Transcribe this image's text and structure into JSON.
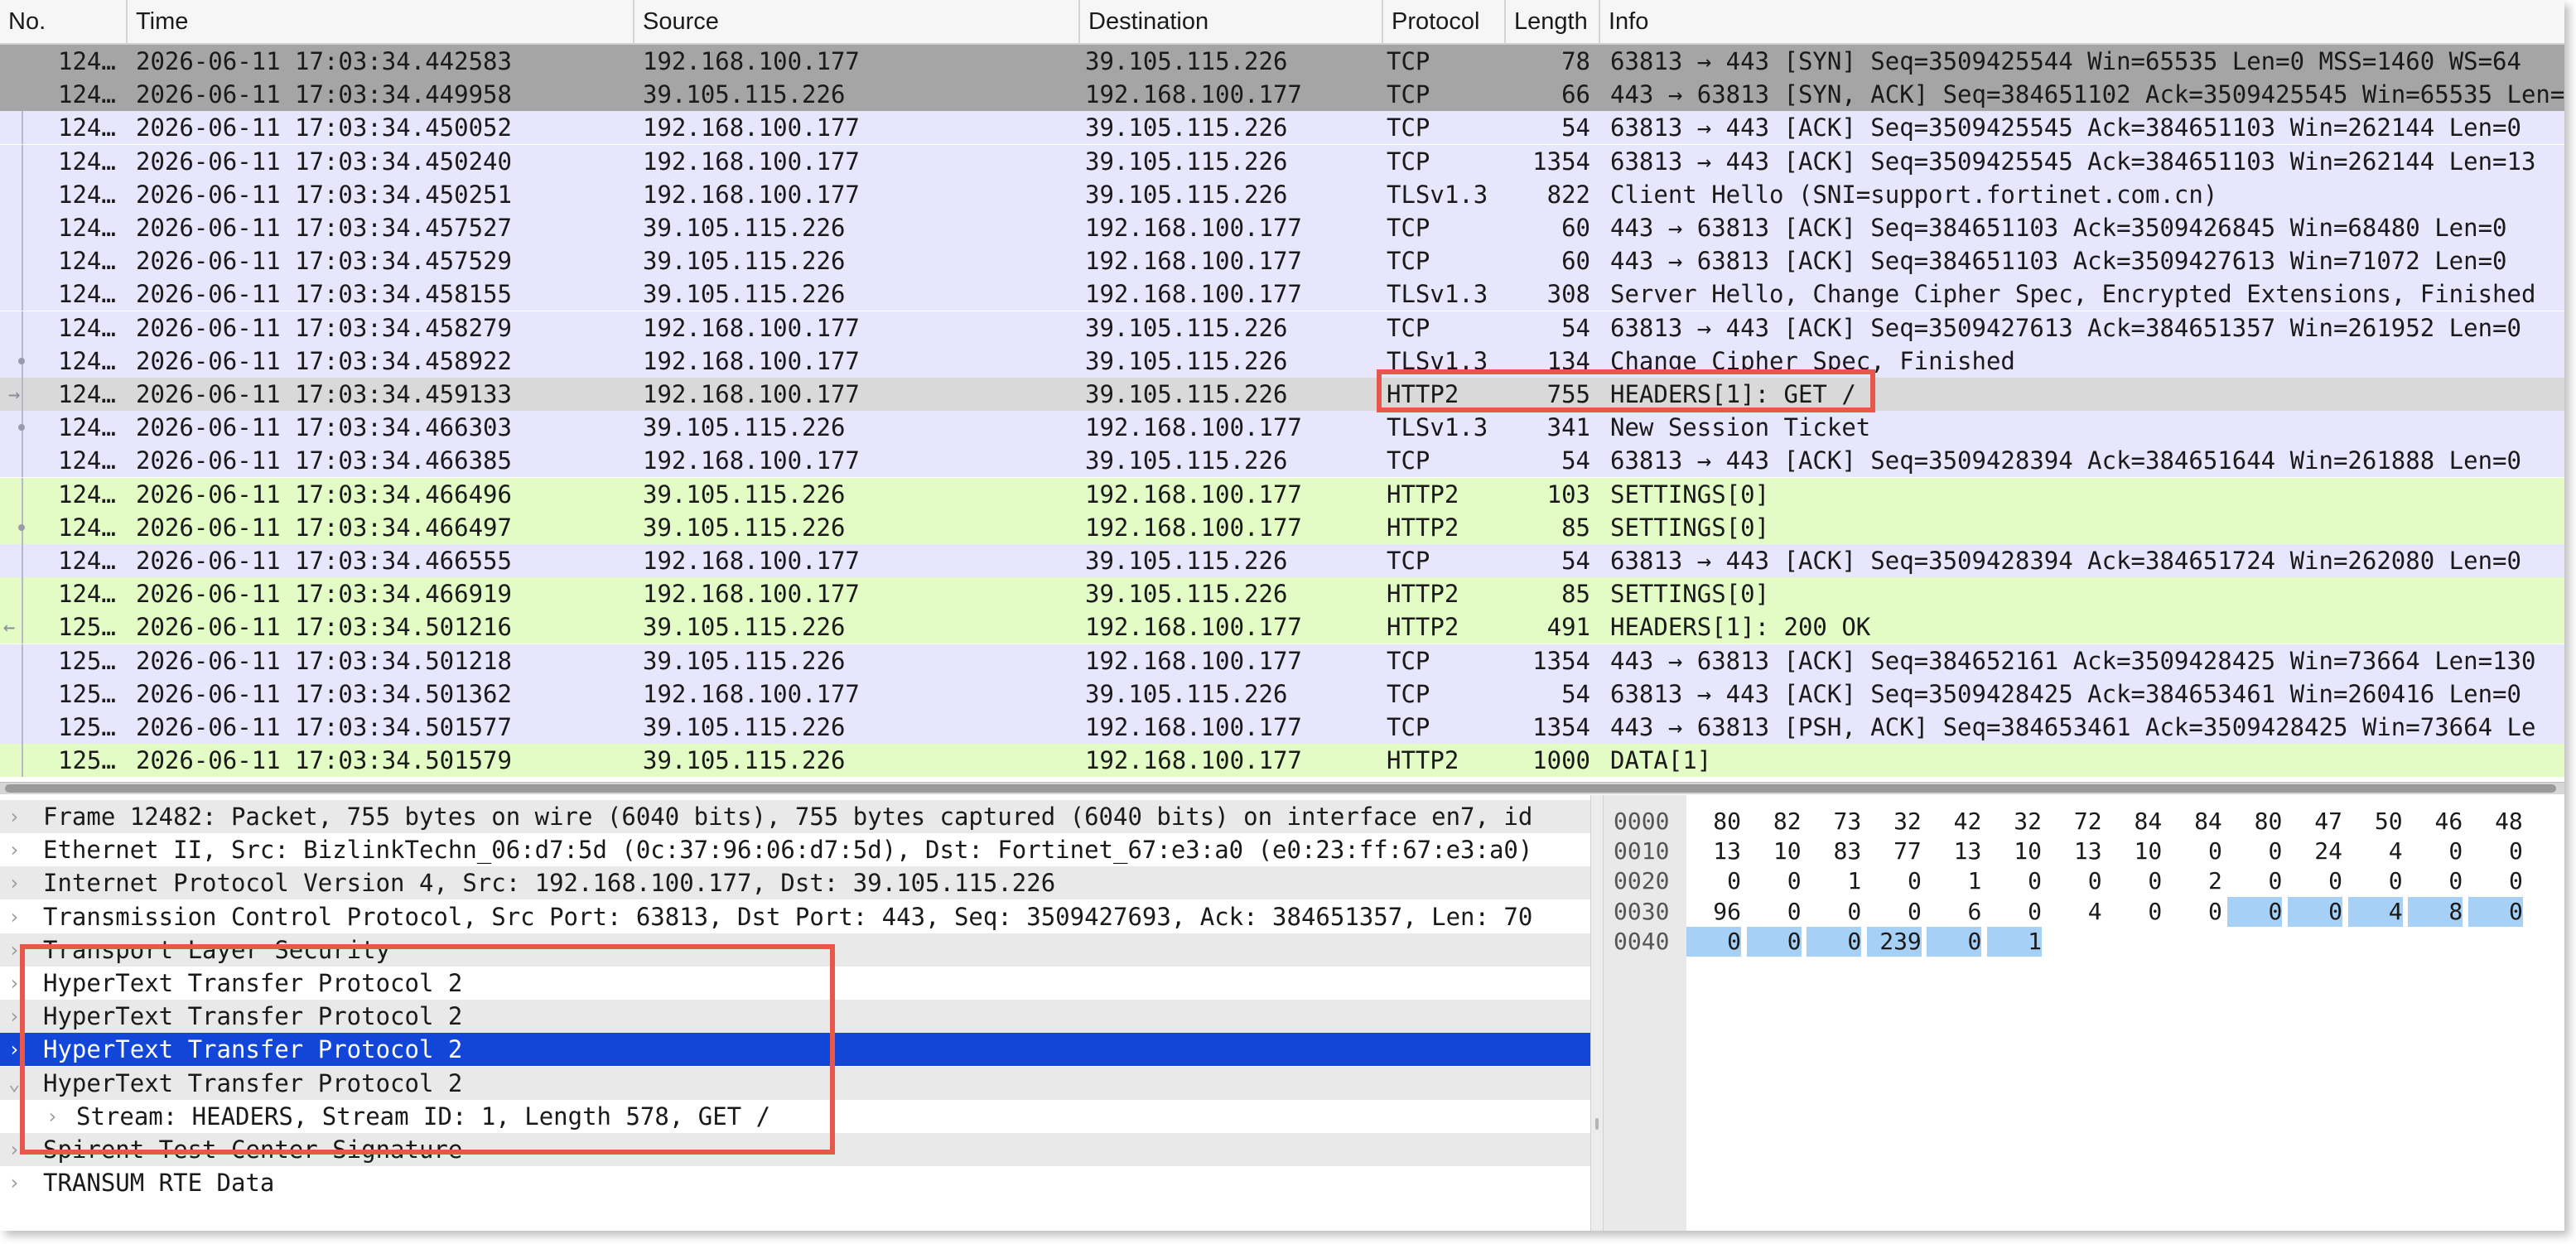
{
  "colors": {
    "row_tcp": "#e8e6fd",
    "row_tcp_syn": "#a5a5a5",
    "row_http2": "#e3fcc5",
    "row_selected_gray": "#d9d9d9",
    "tree_selected": "#1146d9",
    "annotation": "#e8584a",
    "byte_highlight": "#a6d0f5"
  },
  "columns": {
    "no": "No.",
    "time": "Time",
    "source": "Source",
    "destination": "Destination",
    "protocol": "Protocol",
    "length": "Length",
    "info": "Info"
  },
  "packets": [
    {
      "no": "124…",
      "time": "2026-06-11 17:03:34.442583",
      "src": "192.168.100.177",
      "dst": "39.105.115.226",
      "proto": "TCP",
      "len": "78",
      "info": "63813 → 443 [SYN] Seq=3509425544 Win=65535 Len=0 MSS=1460 WS=64",
      "style": "syn",
      "rel": ""
    },
    {
      "no": "124…",
      "time": "2026-06-11 17:03:34.449958",
      "src": "39.105.115.226",
      "dst": "192.168.100.177",
      "proto": "TCP",
      "len": "66",
      "info": "443 → 63813 [SYN, ACK] Seq=384651102 Ack=3509425545 Win=65535 Len=",
      "style": "syn",
      "rel": ""
    },
    {
      "no": "124…",
      "time": "2026-06-11 17:03:34.450052",
      "src": "192.168.100.177",
      "dst": "39.105.115.226",
      "proto": "TCP",
      "len": "54",
      "info": "63813 → 443 [ACK] Seq=3509425545 Ack=384651103 Win=262144 Len=0",
      "style": "tcp",
      "rel": "line"
    },
    {
      "no": "124…",
      "time": "2026-06-11 17:03:34.450240",
      "src": "192.168.100.177",
      "dst": "39.105.115.226",
      "proto": "TCP",
      "len": "1354",
      "info": "63813 → 443 [ACK] Seq=3509425545 Ack=384651103 Win=262144 Len=13",
      "style": "tcp",
      "rel": "line"
    },
    {
      "no": "124…",
      "time": "2026-06-11 17:03:34.450251",
      "src": "192.168.100.177",
      "dst": "39.105.115.226",
      "proto": "TLSv1.3",
      "len": "822",
      "info": "Client Hello (SNI=support.fortinet.com.cn)",
      "style": "tcp",
      "rel": "line"
    },
    {
      "no": "124…",
      "time": "2026-06-11 17:03:34.457527",
      "src": "39.105.115.226",
      "dst": "192.168.100.177",
      "proto": "TCP",
      "len": "60",
      "info": "443 → 63813 [ACK] Seq=384651103 Ack=3509426845 Win=68480 Len=0",
      "style": "tcp",
      "rel": "line"
    },
    {
      "no": "124…",
      "time": "2026-06-11 17:03:34.457529",
      "src": "39.105.115.226",
      "dst": "192.168.100.177",
      "proto": "TCP",
      "len": "60",
      "info": "443 → 63813 [ACK] Seq=384651103 Ack=3509427613 Win=71072 Len=0",
      "style": "tcp",
      "rel": "line"
    },
    {
      "no": "124…",
      "time": "2026-06-11 17:03:34.458155",
      "src": "39.105.115.226",
      "dst": "192.168.100.177",
      "proto": "TLSv1.3",
      "len": "308",
      "info": "Server Hello, Change Cipher Spec, Encrypted Extensions, Finished",
      "style": "tcp",
      "rel": "line"
    },
    {
      "no": "124…",
      "time": "2026-06-11 17:03:34.458279",
      "src": "192.168.100.177",
      "dst": "39.105.115.226",
      "proto": "TCP",
      "len": "54",
      "info": "63813 → 443 [ACK] Seq=3509427613 Ack=384651357 Win=261952 Len=0",
      "style": "tcp",
      "rel": "line"
    },
    {
      "no": "124…",
      "time": "2026-06-11 17:03:34.458922",
      "src": "192.168.100.177",
      "dst": "39.105.115.226",
      "proto": "TLSv1.3",
      "len": "134",
      "info": "Change Cipher Spec, Finished",
      "style": "tcp",
      "rel": "dot"
    },
    {
      "no": "124…",
      "time": "2026-06-11 17:03:34.459133",
      "src": "192.168.100.177",
      "dst": "39.105.115.226",
      "proto": "HTTP2",
      "len": "755",
      "info": "HEADERS[1]: GET /",
      "style": "selected",
      "rel": "arrow-right"
    },
    {
      "no": "124…",
      "time": "2026-06-11 17:03:34.466303",
      "src": "39.105.115.226",
      "dst": "192.168.100.177",
      "proto": "TLSv1.3",
      "len": "341",
      "info": "New Session Ticket",
      "style": "tcp",
      "rel": "dot"
    },
    {
      "no": "124…",
      "time": "2026-06-11 17:03:34.466385",
      "src": "192.168.100.177",
      "dst": "39.105.115.226",
      "proto": "TCP",
      "len": "54",
      "info": "63813 → 443 [ACK] Seq=3509428394 Ack=384651644 Win=261888 Len=0",
      "style": "tcp",
      "rel": "line"
    },
    {
      "no": "124…",
      "time": "2026-06-11 17:03:34.466496",
      "src": "39.105.115.226",
      "dst": "192.168.100.177",
      "proto": "HTTP2",
      "len": "103",
      "info": "SETTINGS[0]",
      "style": "http2",
      "rel": "line"
    },
    {
      "no": "124…",
      "time": "2026-06-11 17:03:34.466497",
      "src": "39.105.115.226",
      "dst": "192.168.100.177",
      "proto": "HTTP2",
      "len": "85",
      "info": "SETTINGS[0]",
      "style": "http2",
      "rel": "dot"
    },
    {
      "no": "124…",
      "time": "2026-06-11 17:03:34.466555",
      "src": "192.168.100.177",
      "dst": "39.105.115.226",
      "proto": "TCP",
      "len": "54",
      "info": "63813 → 443 [ACK] Seq=3509428394 Ack=384651724 Win=262080 Len=0",
      "style": "tcp",
      "rel": "line"
    },
    {
      "no": "124…",
      "time": "2026-06-11 17:03:34.466919",
      "src": "192.168.100.177",
      "dst": "39.105.115.226",
      "proto": "HTTP2",
      "len": "85",
      "info": "SETTINGS[0]",
      "style": "http2",
      "rel": "line"
    },
    {
      "no": "125…",
      "time": "2026-06-11 17:03:34.501216",
      "src": "39.105.115.226",
      "dst": "192.168.100.177",
      "proto": "HTTP2",
      "len": "491",
      "info": "HEADERS[1]: 200 OK",
      "style": "http2",
      "rel": "arrow-left"
    },
    {
      "no": "125…",
      "time": "2026-06-11 17:03:34.501218",
      "src": "39.105.115.226",
      "dst": "192.168.100.177",
      "proto": "TCP",
      "len": "1354",
      "info": "443 → 63813 [ACK] Seq=384652161 Ack=3509428425 Win=73664 Len=130",
      "style": "tcp",
      "rel": "line"
    },
    {
      "no": "125…",
      "time": "2026-06-11 17:03:34.501362",
      "src": "192.168.100.177",
      "dst": "39.105.115.226",
      "proto": "TCP",
      "len": "54",
      "info": "63813 → 443 [ACK] Seq=3509428425 Ack=384653461 Win=260416 Len=0",
      "style": "tcp",
      "rel": "line"
    },
    {
      "no": "125…",
      "time": "2026-06-11 17:03:34.501577",
      "src": "39.105.115.226",
      "dst": "192.168.100.177",
      "proto": "TCP",
      "len": "1354",
      "info": "443 → 63813 [PSH, ACK] Seq=384653461 Ack=3509428425 Win=73664 Le",
      "style": "tcp",
      "rel": "line"
    },
    {
      "no": "125…",
      "time": "2026-06-11 17:03:34.501579",
      "src": "39.105.115.226",
      "dst": "192.168.100.177",
      "proto": "HTTP2",
      "len": "1000",
      "info": "DATA[1]",
      "style": "http2",
      "rel": "line"
    }
  ],
  "details": [
    {
      "label": "Frame 12482: Packet, 755 bytes on wire (6040 bits), 755 bytes captured (6040 bits) on interface en7, id",
      "expander": "›",
      "indent": 0,
      "style": "gray"
    },
    {
      "label": "Ethernet II, Src: BizlinkTechn_06:d7:5d (0c:37:96:06:d7:5d), Dst: Fortinet_67:e3:a0 (e0:23:ff:67:e3:a0)",
      "expander": "›",
      "indent": 0,
      "style": "plain"
    },
    {
      "label": "Internet Protocol Version 4, Src: 192.168.100.177, Dst: 39.105.115.226",
      "expander": "›",
      "indent": 0,
      "style": "gray"
    },
    {
      "label": "Transmission Control Protocol, Src Port: 63813, Dst Port: 443, Seq: 3509427693, Ack: 384651357, Len: 70",
      "expander": "›",
      "indent": 0,
      "style": "plain"
    },
    {
      "label": "Transport Layer Security",
      "expander": "›",
      "indent": 0,
      "style": "gray"
    },
    {
      "label": "HyperText Transfer Protocol 2",
      "expander": "›",
      "indent": 0,
      "style": "plain"
    },
    {
      "label": "HyperText Transfer Protocol 2",
      "expander": "›",
      "indent": 0,
      "style": "gray"
    },
    {
      "label": "HyperText Transfer Protocol 2",
      "expander": "›",
      "indent": 0,
      "style": "selected"
    },
    {
      "label": "HyperText Transfer Protocol 2",
      "expander": "⌄",
      "indent": 0,
      "style": "gray"
    },
    {
      "label": "Stream: HEADERS, Stream ID: 1, Length 578, GET /",
      "expander": "›",
      "indent": 1,
      "style": "plain"
    },
    {
      "label": "Spirent Test Center Signature",
      "expander": "›",
      "indent": 0,
      "style": "gray"
    },
    {
      "label": "TRANSUM RTE Data",
      "expander": "›",
      "indent": 0,
      "style": "plain"
    }
  ],
  "bytes": {
    "rows": [
      {
        "offset": "0000",
        "values": [
          "80",
          "82",
          "73",
          "32",
          "42",
          "32",
          "72",
          "84",
          "84",
          "80",
          "47",
          "50",
          "46",
          "48"
        ],
        "highlight": []
      },
      {
        "offset": "0010",
        "values": [
          "13",
          "10",
          "83",
          "77",
          "13",
          "10",
          "13",
          "10",
          "0",
          "0",
          "24",
          "4",
          "0",
          "0"
        ],
        "highlight": []
      },
      {
        "offset": "0020",
        "values": [
          "0",
          "0",
          "1",
          "0",
          "1",
          "0",
          "0",
          "0",
          "2",
          "0",
          "0",
          "0",
          "0",
          "0"
        ],
        "highlight": []
      },
      {
        "offset": "0030",
        "values": [
          "96",
          "0",
          "0",
          "0",
          "6",
          "0",
          "4",
          "0",
          "0",
          "0",
          "0",
          "4",
          "8",
          "0"
        ],
        "highlight": [
          9,
          10,
          11,
          12,
          13
        ]
      },
      {
        "offset": "0040",
        "values": [
          "0",
          "0",
          "0",
          "239",
          "0",
          "1"
        ],
        "highlight": [
          0,
          1,
          2,
          3,
          4,
          5
        ]
      }
    ]
  }
}
